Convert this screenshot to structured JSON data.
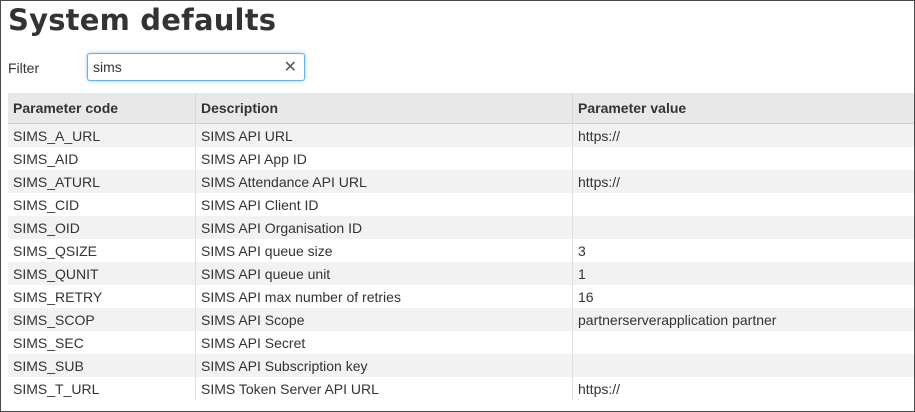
{
  "page": {
    "title": "System defaults"
  },
  "filter": {
    "label": "Filter",
    "value": "sims",
    "clear_glyph": "✕"
  },
  "table": {
    "headers": [
      "Parameter code",
      "Description",
      "Parameter value"
    ],
    "rows": [
      [
        "SIMS_A_URL",
        "SIMS API URL",
        "https://"
      ],
      [
        "SIMS_AID",
        "SIMS API App ID",
        ""
      ],
      [
        "SIMS_ATURL",
        "SIMS Attendance API URL",
        "https://"
      ],
      [
        "SIMS_CID",
        "SIMS API Client ID",
        ""
      ],
      [
        "SIMS_OID",
        "SIMS API Organisation ID",
        ""
      ],
      [
        "SIMS_QSIZE",
        "SIMS API queue size",
        "3"
      ],
      [
        "SIMS_QUNIT",
        "SIMS API queue unit",
        "1"
      ],
      [
        "SIMS_RETRY",
        "SIMS API max number of retries",
        "16"
      ],
      [
        "SIMS_SCOP",
        "SIMS API Scope",
        "partnerserverapplication partner"
      ],
      [
        "SIMS_SEC",
        "SIMS API Secret",
        ""
      ],
      [
        "SIMS_SUB",
        "SIMS API Subscription key",
        ""
      ],
      [
        "SIMS_T_URL",
        "SIMS Token Server API URL",
        "https://"
      ]
    ]
  },
  "icons": {
    "clear": "close-icon"
  }
}
